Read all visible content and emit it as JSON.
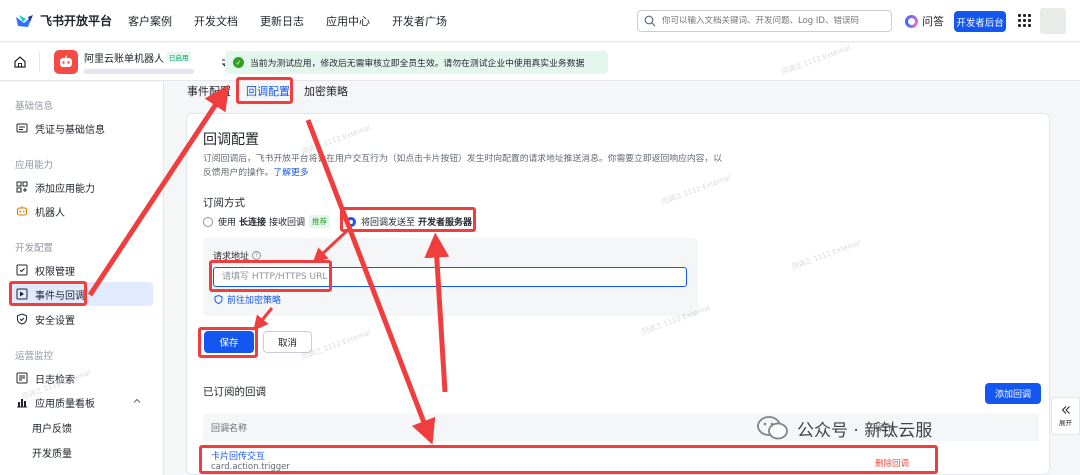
{
  "topnav": {
    "logo_text": "飞书开放平台",
    "links": [
      "客户案例",
      "开发文档",
      "更新日志",
      "应用中心",
      "开发者广场"
    ],
    "search_placeholder": "你可以输入文档关键词、开发问题、Log ID、错误码",
    "ask_label": "问答",
    "dev_console_label": "开发者后台"
  },
  "subheader": {
    "app_name": "阿里云账单机器人",
    "app_status": "已启用",
    "notice": "当前为测试应用，修改后无需审核立即全员生效。请勿在测试企业中使用真实业务数据"
  },
  "sidebar": {
    "groups": [
      {
        "label": "基础信息",
        "items": [
          {
            "label": "凭证与基础信息",
            "icon": "credential-icon"
          }
        ]
      },
      {
        "label": "应用能力",
        "items": [
          {
            "label": "添加应用能力",
            "icon": "apps-icon"
          },
          {
            "label": "机器人",
            "icon": "robot-icon"
          }
        ]
      },
      {
        "label": "开发配置",
        "items": [
          {
            "label": "权限管理",
            "icon": "permission-icon"
          },
          {
            "label": "事件与回调",
            "icon": "event-icon",
            "active": true
          },
          {
            "label": "安全设置",
            "icon": "shield-icon"
          }
        ]
      },
      {
        "label": "运营监控",
        "items": [
          {
            "label": "日志检索",
            "icon": "log-icon"
          },
          {
            "label": "应用质量看板",
            "icon": "chart-icon"
          }
        ]
      }
    ],
    "sub_items": [
      "用户反馈",
      "开发质量"
    ]
  },
  "tabs": [
    {
      "label": "事件配置"
    },
    {
      "label": "回调配置",
      "active": true
    },
    {
      "label": "加密策略"
    }
  ],
  "callback": {
    "title": "回调配置",
    "desc_part1": "订阅回调后，飞书开放平台将会在用户交互行为（如点击卡片按钮）发生时向配置的请求地址推送消息。你需要立即返回响应内容，以反馈用户的操作。",
    "learn_more": "了解更多",
    "subscribe_mode_label": "订阅方式",
    "option1_prefix": "使用",
    "option1_bold": "长连接",
    "option1_suffix": "接收回调",
    "option1_badge": "推荐",
    "option2_prefix": "将回调发送至",
    "option2_bold": "开发者服务器",
    "url_label": "请求地址",
    "url_placeholder": "请填写 HTTP/HTTPS URL",
    "url_value": "",
    "encrypt_link": "前往加密策略",
    "save_label": "保存",
    "cancel_label": "取消",
    "subscribed_title": "已订阅的回调",
    "add_button": "添加回调",
    "columns": [
      "回调名称",
      "操作"
    ],
    "rows": [
      {
        "name": "卡片回传交互",
        "event": "card.action.trigger",
        "action": "删除回调"
      }
    ]
  },
  "watermark": "回调之 1112 External",
  "expand_label": "展开",
  "wechat_label": "公众号 · 新钛云服",
  "colors": {
    "accent": "#1456f0",
    "annotation": "#f03e3e",
    "success": "#2ea121"
  }
}
